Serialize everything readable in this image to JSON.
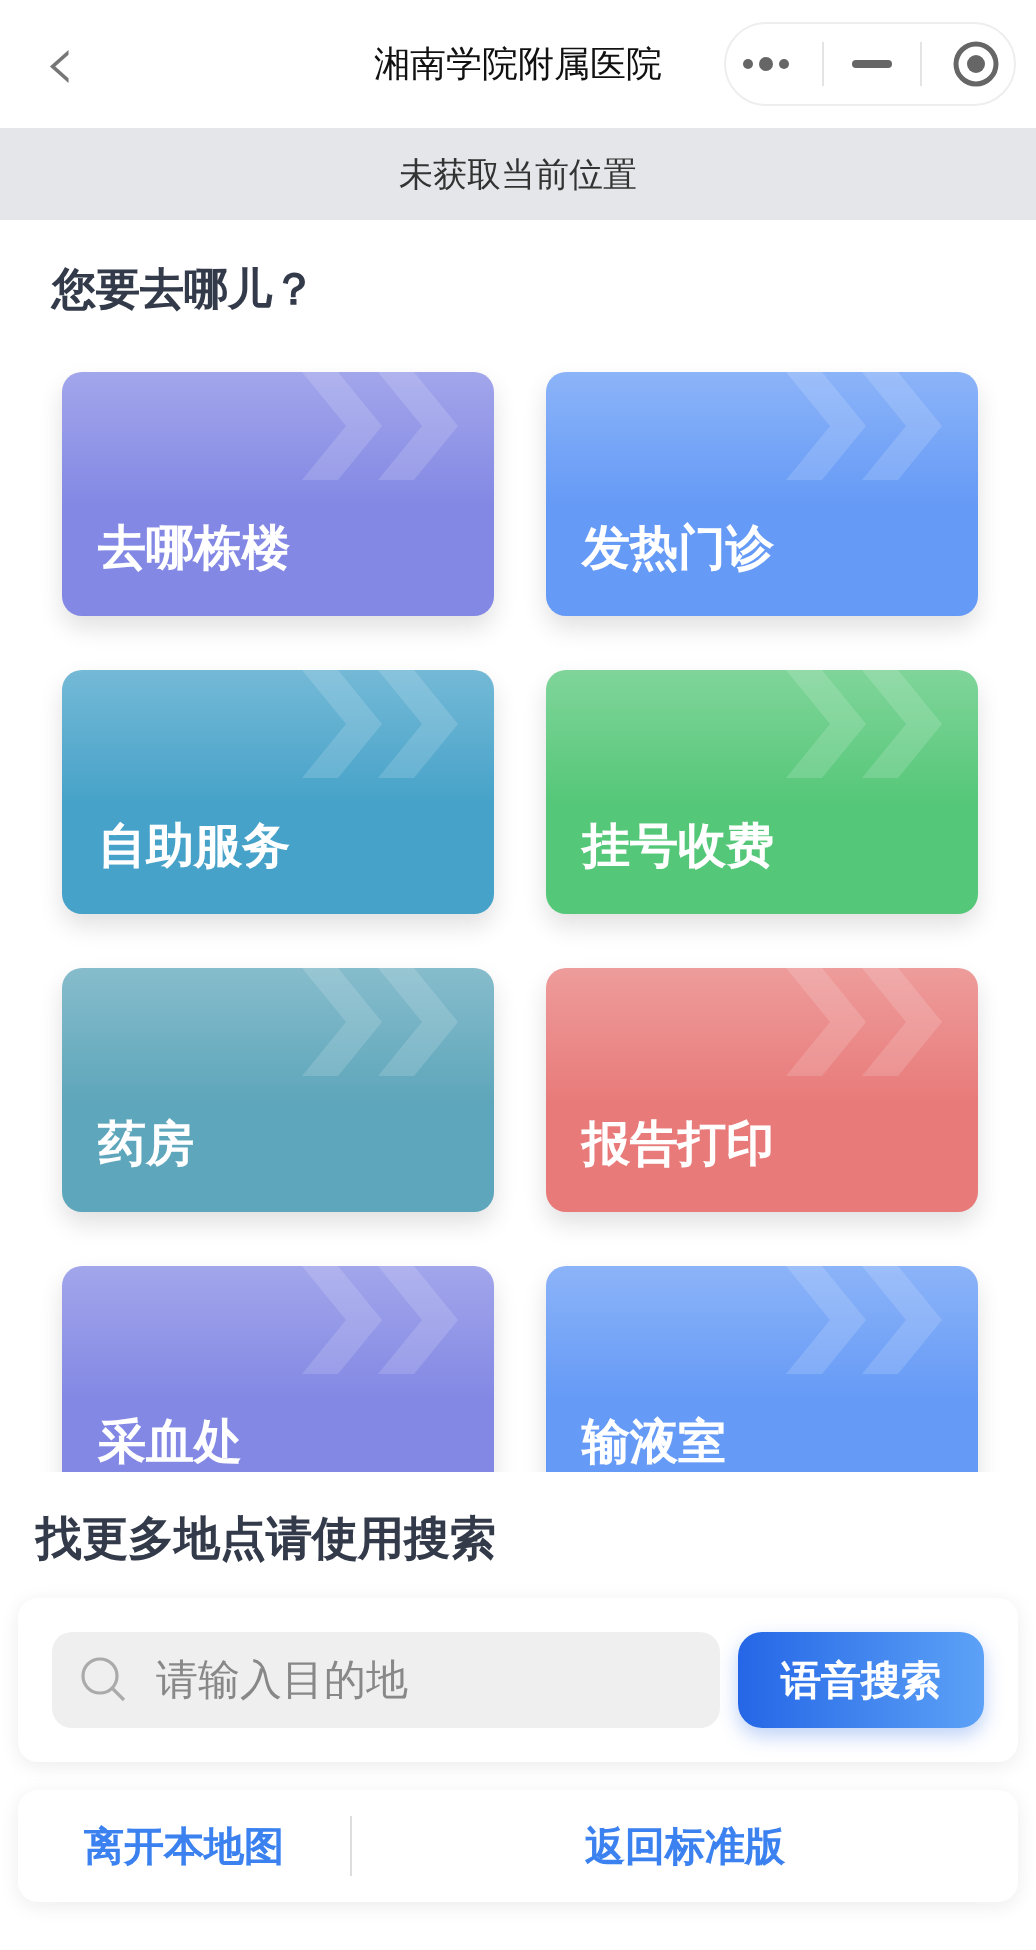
{
  "nav_bar": {
    "back": "‹",
    "title": "湘南学院附属医院"
  },
  "location_banner": "未获取当前位置",
  "heading": "您要去哪儿？",
  "destinations": [
    {
      "label": "去哪栋楼",
      "color": "#8388e4"
    },
    {
      "label": "发热门诊",
      "color": "#659af6"
    },
    {
      "label": "自助服务",
      "color": "#46a2c9"
    },
    {
      "label": "挂号收费",
      "color": "#55c778"
    },
    {
      "label": "药房",
      "color": "#5ea6bb"
    },
    {
      "label": "报告打印",
      "color": "#e87b7a"
    },
    {
      "label": "采血处",
      "color": "#8388e4"
    },
    {
      "label": "输液室",
      "color": "#659af6"
    }
  ],
  "search_heading": "找更多地点请使用搜索",
  "search": {
    "placeholder": "请输入目的地",
    "voice_button": "语音搜索"
  },
  "footer_links": [
    "离开本地图",
    "返回标准版"
  ]
}
